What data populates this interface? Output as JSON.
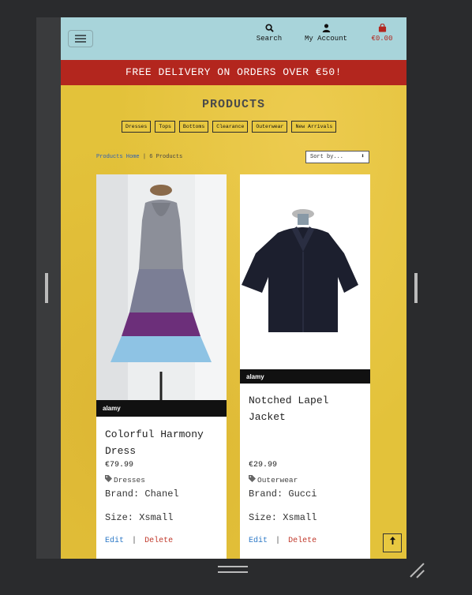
{
  "header": {
    "search_label": "Search",
    "account_label": "My Account",
    "cart_total": "€0.00"
  },
  "banner": {
    "text": "FREE DELIVERY ON ORDERS OVER €50!"
  },
  "page": {
    "title": "PRODUCTS",
    "categories": [
      "Dresses",
      "Tops",
      "Bottoms",
      "Clearance",
      "Outerwear",
      "New Arrivals"
    ],
    "breadcrumb_link": "Products Home",
    "breadcrumb_sep": "|",
    "product_count": "6 Products",
    "sort_value": "Sort by..."
  },
  "products": [
    {
      "name": "Colorful Harmony Dress",
      "price": "€79.99",
      "category": "Dresses",
      "brand": "Brand: Chanel",
      "size": "Size: Xsmall",
      "edit": "Edit",
      "sep": "|",
      "delete": "Delete",
      "watermark": "alamy"
    },
    {
      "name": "Notched Lapel Jacket",
      "price": "€29.99",
      "category": "Outerwear",
      "brand": "Brand: Gucci",
      "size": "Size: Xsmall",
      "edit": "Edit",
      "sep": "|",
      "delete": "Delete",
      "watermark": "alamy"
    }
  ],
  "colors": {
    "header_bg": "#a8d4da",
    "banner_bg": "#b3261e",
    "page_bg": "#e3c23a",
    "link": "#2b78c6",
    "delete": "#c0392b"
  }
}
